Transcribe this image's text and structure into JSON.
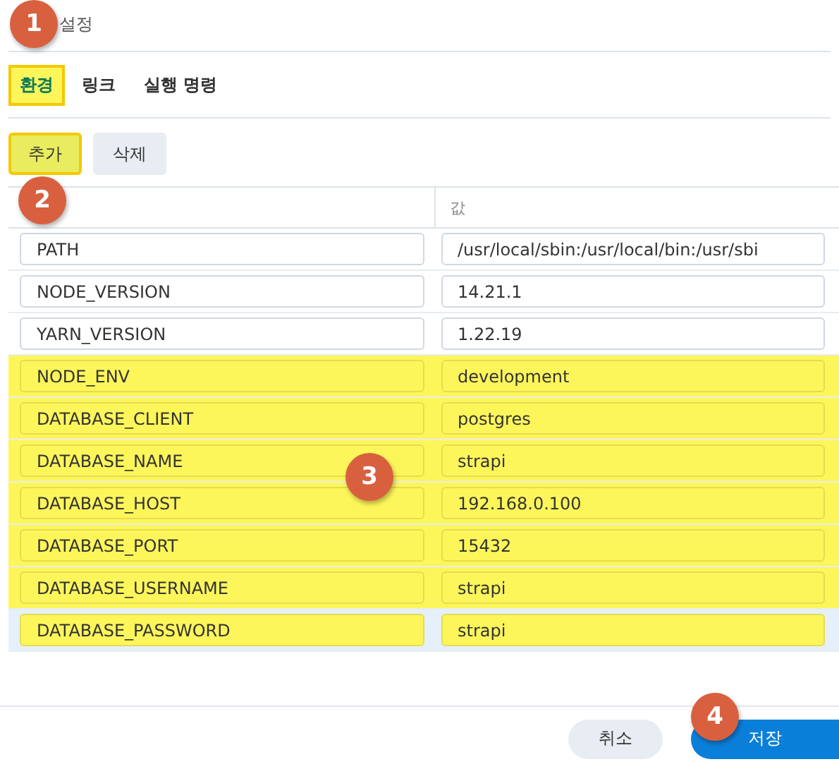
{
  "window": {
    "title": "설정"
  },
  "tabs": [
    {
      "label": "환경",
      "selected": true,
      "highlighted": true
    },
    {
      "label": "링크",
      "selected": false,
      "highlighted": false
    },
    {
      "label": "실행 명령",
      "selected": false,
      "highlighted": false
    }
  ],
  "toolbar": [
    {
      "label": "추가",
      "highlighted": true
    },
    {
      "label": "삭제",
      "highlighted": false
    }
  ],
  "table": {
    "columns": [
      "값"
    ],
    "rows": [
      {
        "name": "PATH",
        "value": "/usr/local/sbin:/usr/local/bin:/usr/sbi",
        "selected": false,
        "highlighted": false
      },
      {
        "name": "NODE_VERSION",
        "value": "14.21.1",
        "selected": false,
        "highlighted": false
      },
      {
        "name": "YARN_VERSION",
        "value": "1.22.19",
        "selected": false,
        "highlighted": false
      },
      {
        "name": "NODE_ENV",
        "value": "development",
        "selected": false,
        "highlighted": true
      },
      {
        "name": "DATABASE_CLIENT",
        "value": "postgres",
        "selected": false,
        "highlighted": true
      },
      {
        "name": "DATABASE_NAME",
        "value": "strapi",
        "selected": false,
        "highlighted": true
      },
      {
        "name": "DATABASE_HOST",
        "value": "192.168.0.100",
        "selected": false,
        "highlighted": true
      },
      {
        "name": "DATABASE_PORT",
        "value": "15432",
        "selected": false,
        "highlighted": true
      },
      {
        "name": "DATABASE_USERNAME",
        "value": "strapi",
        "selected": false,
        "highlighted": true
      },
      {
        "name": "DATABASE_PASSWORD",
        "value": "strapi",
        "selected": true,
        "highlighted": true
      }
    ]
  },
  "footer": {
    "buttons": [
      {
        "label": "취소",
        "kind": "secondary"
      },
      {
        "label": "저장",
        "kind": "primary"
      }
    ]
  },
  "annotations": [
    {
      "number": "1"
    },
    {
      "number": "2"
    },
    {
      "number": "3"
    },
    {
      "number": "4"
    }
  ]
}
